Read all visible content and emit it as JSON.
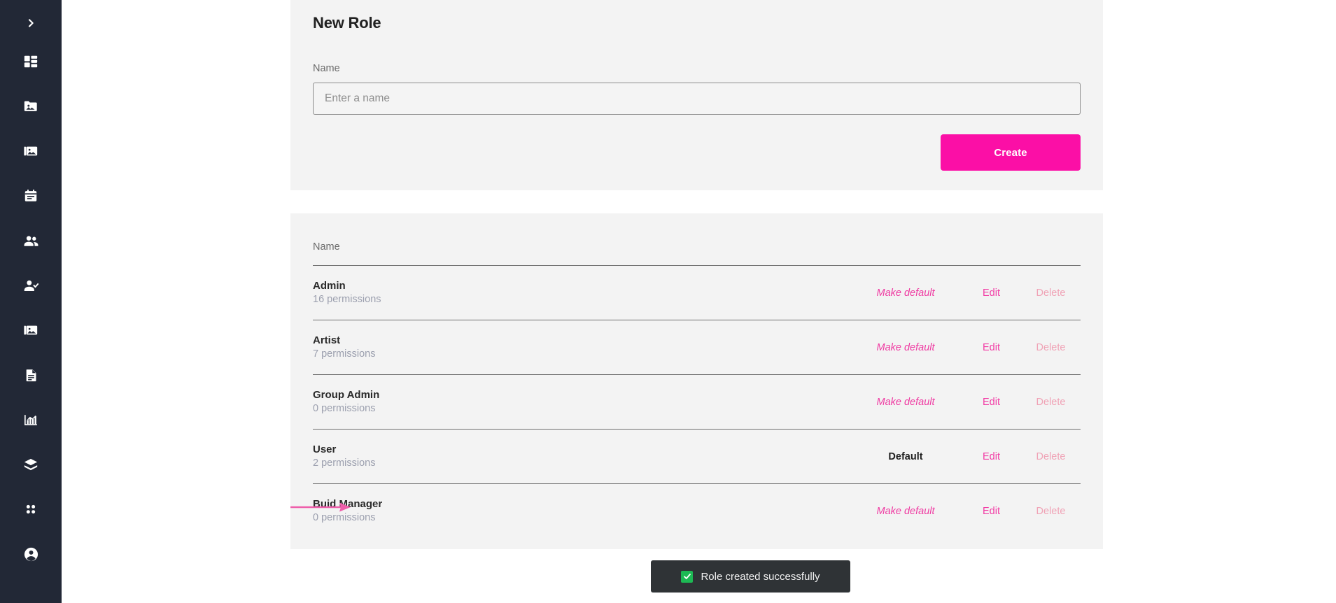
{
  "sidebar": {
    "toggle": {
      "icon": "chevron-right-icon",
      "label": "Expand sidebar"
    },
    "items": [
      {
        "icon": "dashboard-icon",
        "label": "Dashboard"
      },
      {
        "icon": "folder-image-icon",
        "label": "Collections"
      },
      {
        "icon": "images-icon",
        "label": "Media"
      },
      {
        "icon": "calendar-icon",
        "label": "Calendar"
      },
      {
        "icon": "people-icon",
        "label": "Groups"
      },
      {
        "icon": "person-check-icon",
        "label": "Users"
      },
      {
        "icon": "photo-library-icon",
        "label": "Gallery"
      },
      {
        "icon": "document-icon",
        "label": "Documents"
      },
      {
        "icon": "bar-chart-icon",
        "label": "Reports"
      },
      {
        "icon": "box-icon",
        "label": "Packages"
      },
      {
        "icon": "grid-dots-icon",
        "label": "Apps"
      },
      {
        "icon": "account-circle-icon",
        "label": "Account"
      }
    ]
  },
  "form": {
    "title": "New Role",
    "name_label": "Name",
    "name_value": "",
    "name_placeholder": "Enter a name",
    "create_label": "Create"
  },
  "list": {
    "header_name": "Name",
    "action_make_default": "Make default",
    "action_default": "Default",
    "action_edit": "Edit",
    "action_delete": "Delete",
    "rows": [
      {
        "name": "Admin",
        "permissions": "16 permissions",
        "is_default": false
      },
      {
        "name": "Artist",
        "permissions": "7 permissions",
        "is_default": false
      },
      {
        "name": "Group Admin",
        "permissions": "0 permissions",
        "is_default": false
      },
      {
        "name": "User",
        "permissions": "2 permissions",
        "is_default": true
      },
      {
        "name": "Buid Manager",
        "permissions": "0 permissions",
        "is_default": false
      }
    ]
  },
  "annotation": {
    "arrow": "arrow-right-annotation",
    "target": "Buid Manager"
  },
  "toast": {
    "icon": "check-square-icon",
    "message": "Role created successfully"
  },
  "colors": {
    "accent_pink": "#fb0fa6",
    "link_pink": "#f23ca5",
    "delete_pink": "#f0a3b6",
    "sidebar_bg": "#222836",
    "panel_bg": "#f3f3f3",
    "toast_bg": "#2f3336",
    "toast_check_green": "#1db954",
    "annotation_pink": "#ee5fab"
  }
}
